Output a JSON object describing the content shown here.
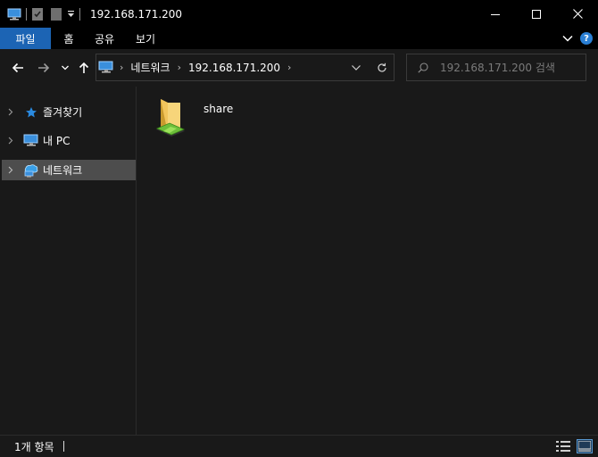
{
  "window": {
    "title": "192.168.171.200"
  },
  "ribbon": {
    "tabs": [
      {
        "label": "파일"
      },
      {
        "label": "홈"
      },
      {
        "label": "공유"
      },
      {
        "label": "보기"
      }
    ],
    "help_label": "?"
  },
  "navigation": {
    "breadcrumb": [
      "네트워크",
      "192.168.171.200"
    ],
    "search_placeholder": "192.168.171.200 검색"
  },
  "sidebar": {
    "items": [
      {
        "label": "즐겨찾기",
        "icon": "star-icon"
      },
      {
        "label": "내 PC",
        "icon": "pc-icon"
      },
      {
        "label": "네트워크",
        "icon": "network-icon",
        "selected": true
      }
    ]
  },
  "content": {
    "items": [
      {
        "name": "share",
        "icon": "shared-folder-icon"
      }
    ]
  },
  "status": {
    "count_text": "1개 항목"
  },
  "colors": {
    "accent": "#1c64b4",
    "background": "#191919",
    "titlebar": "#000000",
    "selected": "#4d4d4d"
  }
}
